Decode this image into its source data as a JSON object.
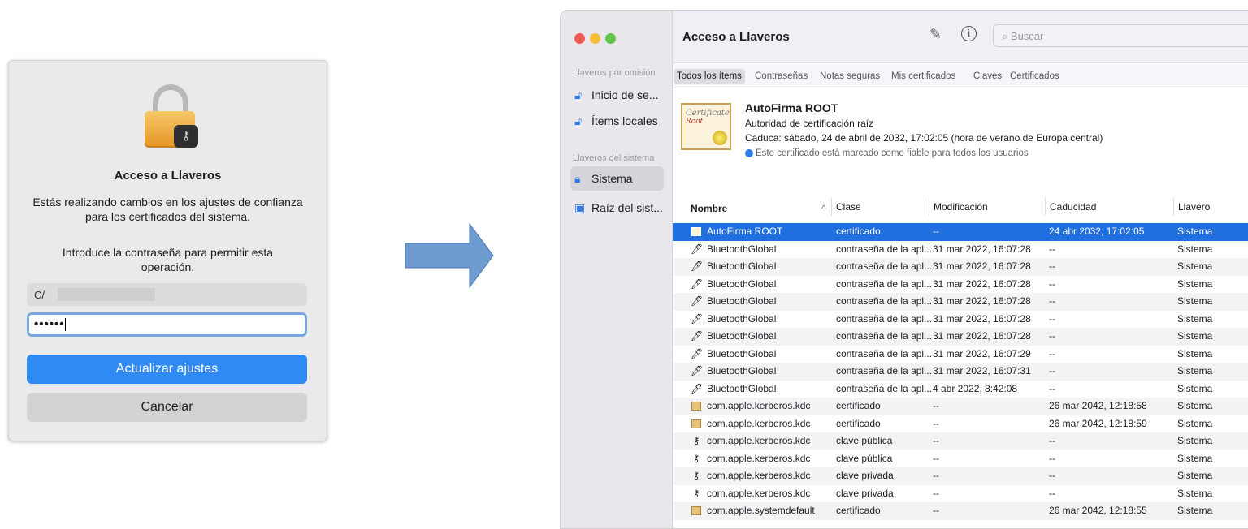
{
  "dialog": {
    "title": "Acceso a Llaveros",
    "message": "Estás realizando cambios en los ajustes de confianza para los certificados del sistema.",
    "prompt": "Introduce la contraseña para permitir esta operación.",
    "username_value": "C/",
    "password_value": "••••••",
    "update_button": "Actualizar ajustes",
    "cancel_button": "Cancelar"
  },
  "window": {
    "title": "Acceso a Llaveros",
    "search_placeholder": "Buscar"
  },
  "sidebar": {
    "default_header": "Llaveros por omisión",
    "default_items": [
      {
        "label": "Inicio de se...",
        "icon": "unlocked-lock-icon"
      },
      {
        "label": "Ítems locales",
        "icon": "unlocked-lock-icon"
      }
    ],
    "system_header": "Llaveros del sistema",
    "system_items": [
      {
        "label": "Sistema",
        "icon": "lock-icon",
        "selected": true
      },
      {
        "label": "Raíz del sist...",
        "icon": "cabinet-icon",
        "selected": false
      }
    ]
  },
  "tabs": [
    "Todos los ítems",
    "Contraseñas",
    "Notas seguras",
    "Mis certificados",
    "Claves",
    "Certificados"
  ],
  "detail": {
    "cert_icon_text": "Certificate",
    "cert_icon_sub": "Root",
    "name": "AutoFirma ROOT",
    "kind": "Autoridad de certificación raíz",
    "expires": "Caduca: sábado, 24 de abril de 2032, 17:02:05 (hora de verano de Europa central)",
    "trust": "Este certificado está marcado como fiable para todos los usuarios"
  },
  "table": {
    "columns": [
      "Nombre",
      "Clase",
      "Modificación",
      "Caducidad",
      "Llavero"
    ],
    "sort_indicator": "^",
    "rows": [
      {
        "icon": "certificate-icon",
        "name": "AutoFirma ROOT",
        "kind": "certificado",
        "modified": "--",
        "expires": "24 abr 2032, 17:02:05",
        "keychain": "Sistema",
        "selected": true
      },
      {
        "icon": "pen-icon",
        "name": "BluetoothGlobal",
        "kind": "contraseña de la apl...",
        "modified": "31 mar 2022, 16:07:28",
        "expires": "--",
        "keychain": "Sistema"
      },
      {
        "icon": "pen-icon",
        "name": "BluetoothGlobal",
        "kind": "contraseña de la apl...",
        "modified": "31 mar 2022, 16:07:28",
        "expires": "--",
        "keychain": "Sistema"
      },
      {
        "icon": "pen-icon",
        "name": "BluetoothGlobal",
        "kind": "contraseña de la apl...",
        "modified": "31 mar 2022, 16:07:28",
        "expires": "--",
        "keychain": "Sistema"
      },
      {
        "icon": "pen-icon",
        "name": "BluetoothGlobal",
        "kind": "contraseña de la apl...",
        "modified": "31 mar 2022, 16:07:28",
        "expires": "--",
        "keychain": "Sistema"
      },
      {
        "icon": "pen-icon",
        "name": "BluetoothGlobal",
        "kind": "contraseña de la apl...",
        "modified": "31 mar 2022, 16:07:28",
        "expires": "--",
        "keychain": "Sistema"
      },
      {
        "icon": "pen-icon",
        "name": "BluetoothGlobal",
        "kind": "contraseña de la apl...",
        "modified": "31 mar 2022, 16:07:28",
        "expires": "--",
        "keychain": "Sistema"
      },
      {
        "icon": "pen-icon",
        "name": "BluetoothGlobal",
        "kind": "contraseña de la apl...",
        "modified": "31 mar 2022, 16:07:29",
        "expires": "--",
        "keychain": "Sistema"
      },
      {
        "icon": "pen-icon",
        "name": "BluetoothGlobal",
        "kind": "contraseña de la apl...",
        "modified": "31 mar 2022, 16:07:31",
        "expires": "--",
        "keychain": "Sistema"
      },
      {
        "icon": "pen-icon",
        "name": "BluetoothGlobal",
        "kind": "contraseña de la apl...",
        "modified": "4 abr 2022, 8:42:08",
        "expires": "--",
        "keychain": "Sistema"
      },
      {
        "icon": "certificate-icon",
        "name": "com.apple.kerberos.kdc",
        "kind": "certificado",
        "modified": "--",
        "expires": "26 mar 2042, 12:18:58",
        "keychain": "Sistema"
      },
      {
        "icon": "certificate-icon",
        "name": "com.apple.kerberos.kdc",
        "kind": "certificado",
        "modified": "--",
        "expires": "26 mar 2042, 12:18:59",
        "keychain": "Sistema"
      },
      {
        "icon": "key-icon",
        "name": "com.apple.kerberos.kdc",
        "kind": "clave pública",
        "modified": "--",
        "expires": "--",
        "keychain": "Sistema"
      },
      {
        "icon": "key-icon",
        "name": "com.apple.kerberos.kdc",
        "kind": "clave pública",
        "modified": "--",
        "expires": "--",
        "keychain": "Sistema"
      },
      {
        "icon": "key-icon",
        "name": "com.apple.kerberos.kdc",
        "kind": "clave privada",
        "modified": "--",
        "expires": "--",
        "keychain": "Sistema"
      },
      {
        "icon": "key-icon",
        "name": "com.apple.kerberos.kdc",
        "kind": "clave privada",
        "modified": "--",
        "expires": "--",
        "keychain": "Sistema"
      },
      {
        "icon": "certificate-icon",
        "name": "com.apple.systemdefault",
        "kind": "certificado",
        "modified": "--",
        "expires": "26 mar 2042, 12:18:55",
        "keychain": "Sistema"
      }
    ]
  },
  "colors": {
    "accent": "#2f8af4",
    "selection": "#1f6fde",
    "arrow": "#6e9bd0"
  }
}
